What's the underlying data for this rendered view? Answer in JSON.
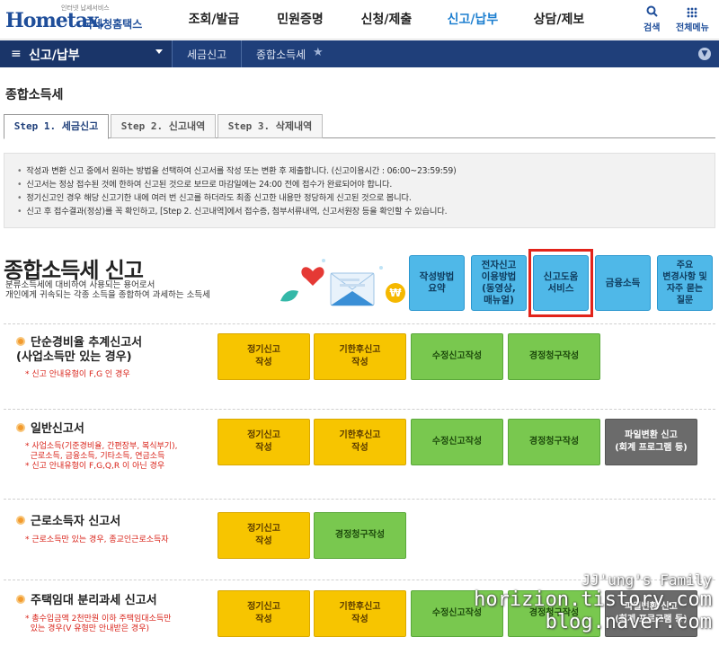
{
  "header": {
    "logo_tag": "인터넷 납세서비스",
    "logo_text": "Hometax.",
    "logo_kor": "국세청홈택스",
    "nav": [
      {
        "label": "조회/발급",
        "active": false
      },
      {
        "label": "민원증명",
        "active": false
      },
      {
        "label": "신청/제출",
        "active": false
      },
      {
        "label": "신고/납부",
        "active": true
      },
      {
        "label": "상담/제보",
        "active": false
      }
    ],
    "search_label": "검색",
    "allmenu_label": "전체메뉴"
  },
  "breadcrumb": {
    "menu_label": "신고/납부",
    "level1": "세금신고",
    "level2": "종합소득세"
  },
  "page_title": "종합소득세",
  "tabs": [
    {
      "label": "Step 1. 세금신고",
      "active": true
    },
    {
      "label": "Step 2. 신고내역",
      "active": false
    },
    {
      "label": "Step 3. 삭제내역",
      "active": false
    }
  ],
  "info": [
    "작성과 변환 신고 중에서 원하는 방법을 선택하여 신고서를 작성 또는 변환 후 제출합니다. (신고이용시간 : 06:00~23:59:59)",
    "신고서는 정상 접수된 것에 한하여 신고된 것으로 보므로 마감일에는 24:00 전에 접수가 완료되어야 합니다.",
    "정기신고인 경우 해당 신고기한 내에 여러 번 신고를 하더라도 최종 신고한 내용만 정당하게 신고된 것으로 봅니다.",
    "신고 후 접수결과(정상)를 꼭 확인하고, [Step 2. 신고내역]에서 접수증, 첨부서류내역, 신고서원장 등을 확인할 수 있습니다."
  ],
  "section_header": {
    "title": "종합소득세 신고",
    "subtitle_line1": "분류소득세에 대비하여 사용되는 용어로서",
    "subtitle_line2": "개인에게 귀속되는 각종 소득을 종합하여 과세하는 소득세"
  },
  "service_buttons": [
    {
      "label": "작성방법\n요약"
    },
    {
      "label": "전자신고\n이용방법\n(동영상,\n매뉴얼)"
    },
    {
      "label": "신고도움\n서비스"
    },
    {
      "label": "금융소득"
    },
    {
      "label": "주요\n변경사항 및\n자주 묻는\n질문"
    }
  ],
  "sections": [
    {
      "title": "단순경비율 추계신고서\n(사업소득만 있는 경우)",
      "notes": [
        "* 신고 안내유형이 F,G 인 경우"
      ],
      "actions": [
        {
          "label": "정기신고\n작성",
          "color": "yellow"
        },
        {
          "label": "기한후신고\n작성",
          "color": "yellow"
        },
        {
          "label": "수정신고작성",
          "color": "green"
        },
        {
          "label": "경정청구작성",
          "color": "green"
        }
      ]
    },
    {
      "title": "일반신고서",
      "notes": [
        "* 사업소득(기준경비율, 간편장부, 복식부기),",
        "  근로소득, 금융소득, 기타소득, 연금소득",
        "* 신고 안내유형이 F,G,Q,R 이 아닌 경우"
      ],
      "actions": [
        {
          "label": "정기신고\n작성",
          "color": "yellow"
        },
        {
          "label": "기한후신고\n작성",
          "color": "yellow"
        },
        {
          "label": "수정신고작성",
          "color": "green"
        },
        {
          "label": "경정청구작성",
          "color": "green"
        },
        {
          "label": "파일변환 신고\n(회계 프로그램 등)",
          "color": "gray"
        }
      ]
    },
    {
      "title": "근로소득자 신고서",
      "notes": [
        "* 근로소득만 있는 경우, 종교인근로소득자"
      ],
      "actions": [
        {
          "label": "정기신고\n작성",
          "color": "yellow"
        },
        {
          "label": "경정청구작성",
          "color": "green"
        }
      ]
    },
    {
      "title": "주택임대 분리과세 신고서",
      "notes": [
        "* 총수입금액 2천만원 이하 주택임대소득만",
        "  있는 경우(V 유형만 안내받은 경우)"
      ],
      "actions": [
        {
          "label": "정기신고\n작성",
          "color": "yellow"
        },
        {
          "label": "기한후신고\n작성",
          "color": "yellow"
        },
        {
          "label": "수정신고작성",
          "color": "green"
        },
        {
          "label": "경정청구작성",
          "color": "green"
        },
        {
          "label": "파일변환 신고\n(회계 프로그램 등)",
          "color": "gray"
        }
      ]
    }
  ],
  "watermark": {
    "line1": "JJ'ung's Family",
    "line2": "horizion.tistory.com",
    "line3": "blog.naver.com"
  },
  "colors": {
    "brand_blue": "#1f3f7a",
    "active_nav": "#1d7fd0",
    "service_blue": "#4fb8e8",
    "highlight_red": "#e2231a",
    "action_yellow": "#f7c500",
    "action_green": "#79c84f",
    "action_gray": "#6b6b6b"
  }
}
